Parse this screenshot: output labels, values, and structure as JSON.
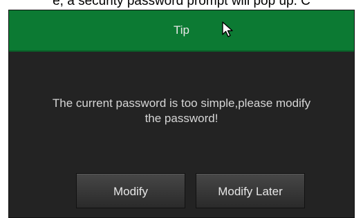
{
  "caption": {
    "text": "e, a security password prompt will pop up. C"
  },
  "dialog": {
    "title": "Tip",
    "message_line1": "The current password is too simple,please modify",
    "message_line2": "the password!",
    "buttons": {
      "modify_label": "Modify",
      "later_label": "Modify Later"
    }
  },
  "colors": {
    "titlebar": "#0c7a33",
    "body": "#232323",
    "text": "#d6d6d6"
  },
  "icons": {
    "cursor": "mouse-cursor-icon"
  }
}
